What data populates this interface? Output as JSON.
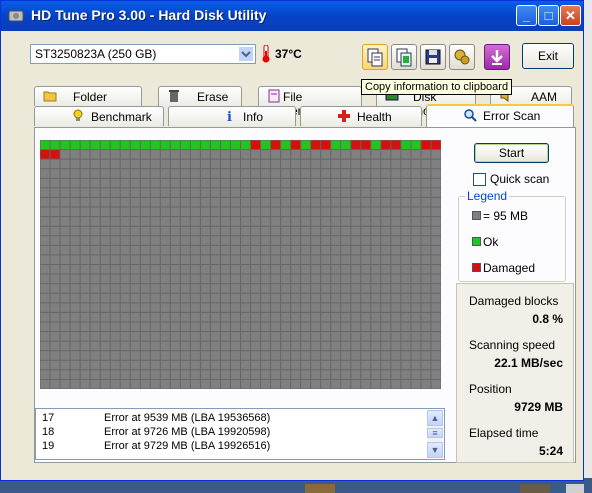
{
  "window": {
    "title": "HD Tune Pro 3.00 - Hard Disk Utility",
    "minimize": "_",
    "maximize": "□",
    "close": "✕"
  },
  "toolbar": {
    "drive": "ST3250823A (250 GB)",
    "temperature": "37°C",
    "exit_label": "Exit",
    "tooltip": "Copy information to clipboard",
    "tools": [
      "copy-text-icon",
      "copy-screenshot-icon",
      "save-icon",
      "options-icon",
      "download-icon"
    ]
  },
  "tabs_row1": [
    {
      "label": "Folder Usage",
      "icon": "folder-icon"
    },
    {
      "label": "Erase",
      "icon": "trash-icon"
    },
    {
      "label": "File Benchmark",
      "icon": "file-benchmark-icon"
    },
    {
      "label": "Disk monitor",
      "icon": "monitor-icon"
    },
    {
      "label": "AAM",
      "icon": "speaker-icon"
    }
  ],
  "tabs_row2": [
    {
      "label": "Benchmark",
      "icon": "lightbulb-icon"
    },
    {
      "label": "Info",
      "icon": "info-icon"
    },
    {
      "label": "Health",
      "icon": "health-cross-icon"
    },
    {
      "label": "Error Scan",
      "icon": "magnifier-icon",
      "selected": true
    }
  ],
  "scan_grid": {
    "columns": 40,
    "rows": 26,
    "colors": {
      "unscanned": "#808080",
      "ok": "#22c322",
      "damaged": "#d41010"
    },
    "row0_damaged": [
      21,
      23,
      25,
      27,
      28,
      31,
      32,
      34,
      35,
      38,
      39
    ],
    "row0_ok_count": 40,
    "row1_damaged": [
      0,
      1
    ]
  },
  "log": {
    "entries": [
      {
        "n": "17",
        "msg": "Error at 9539 MB (LBA 19536568)"
      },
      {
        "n": "18",
        "msg": "Error at 9726 MB (LBA 19920598)"
      },
      {
        "n": "19",
        "msg": "Error at 9729 MB (LBA 19926516)"
      }
    ]
  },
  "side": {
    "start_label": "Start",
    "quick_scan_label": "Quick scan",
    "quick_scan_checked": false,
    "legend_title": "Legend",
    "legend": [
      {
        "label": "= 95 MB",
        "color": "#808080"
      },
      {
        "label": "Ok",
        "color": "#22c322"
      },
      {
        "label": "Damaged",
        "color": "#d41010"
      }
    ]
  },
  "stats": {
    "damaged_label": "Damaged blocks",
    "damaged_value": "0.8 %",
    "speed_label": "Scanning speed",
    "speed_value": "22.1 MB/sec",
    "position_label": "Position",
    "position_value": "9729 MB",
    "elapsed_label": "Elapsed time",
    "elapsed_value": "5:24"
  }
}
